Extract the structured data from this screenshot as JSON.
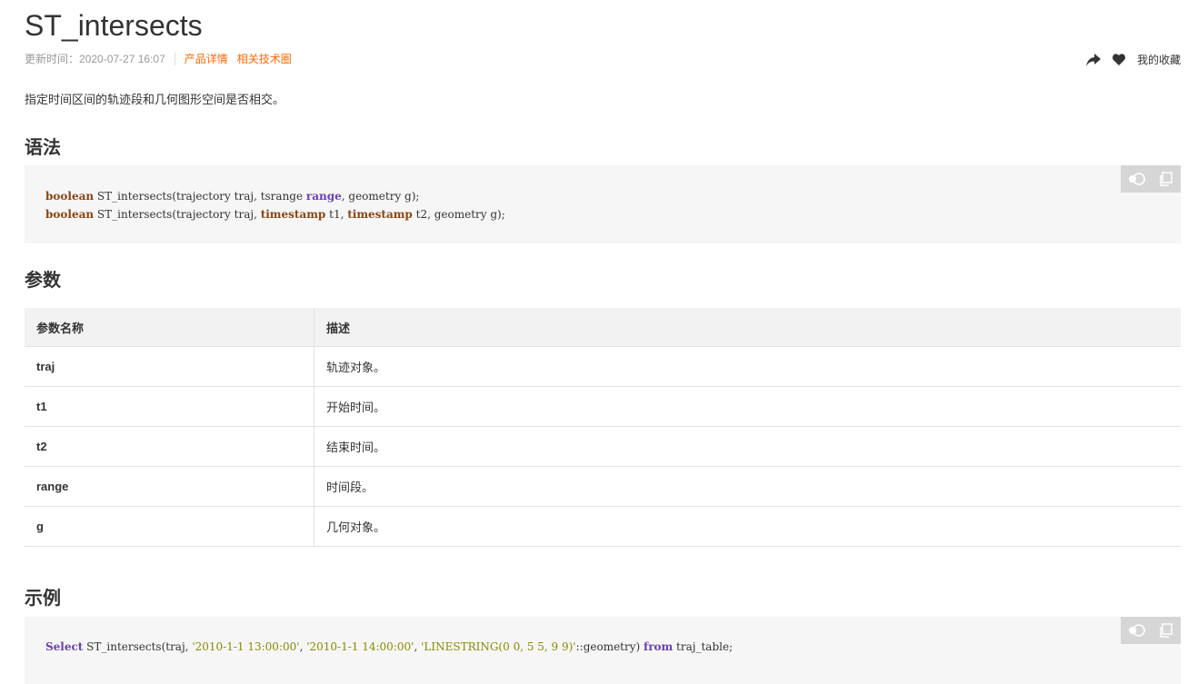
{
  "doc": {
    "title": "ST_intersects",
    "update_label": "更新时间：",
    "update_time": "2020-07-27 16:07",
    "links": [
      "产品详情",
      "相关技术圈"
    ],
    "favorite_label": "我的收藏",
    "description": "指定时间区间的轨迹段和几何图形空间是否相交。"
  },
  "sections": {
    "syntax": "语法",
    "params": "参数",
    "example": "示例"
  },
  "syntax_code": {
    "line1": {
      "kw": "boolean",
      "p1": " ST_intersects(trajectory traj, tsrange ",
      "kw2": "range",
      "p2": ", geometry g);"
    },
    "line2": {
      "kw": "boolean",
      "p1": " ST_intersects(trajectory traj, ",
      "kw2": "timestamp",
      "p2": " t1, ",
      "kw3": "timestamp",
      "p3": " t2, geometry g);"
    }
  },
  "params_table": {
    "headers": [
      "参数名称",
      "描述"
    ],
    "rows": [
      {
        "name": "traj",
        "desc": "轨迹对象。"
      },
      {
        "name": "t1",
        "desc": "开始时间。"
      },
      {
        "name": "t2",
        "desc": "结束时间。"
      },
      {
        "name": "range",
        "desc": "时间段。"
      },
      {
        "name": "g",
        "desc": "几何对象。"
      }
    ]
  },
  "example_code": {
    "kw": "Select",
    "p1": " ST_intersects(traj, ",
    "s1": "'2010-1-1 13:00:00'",
    "p2": ", ",
    "s2": "'2010-1-1 14:00:00'",
    "p3": ", ",
    "s3": "'LINESTRING(0 0, 5 5, 9 9)'",
    "p4": "::geometry) ",
    "kw2": "from",
    "p5": " traj_table;"
  },
  "icons": {
    "share": "share-icon",
    "favorite": "heart-icon",
    "theme_toggle": "theme-toggle-icon",
    "copy": "copy-icon"
  },
  "colors": {
    "accent": "#ff6a00",
    "keyword": "#8b4513",
    "keyword_alt": "#6a3fb5",
    "string": "#8a8a00"
  }
}
